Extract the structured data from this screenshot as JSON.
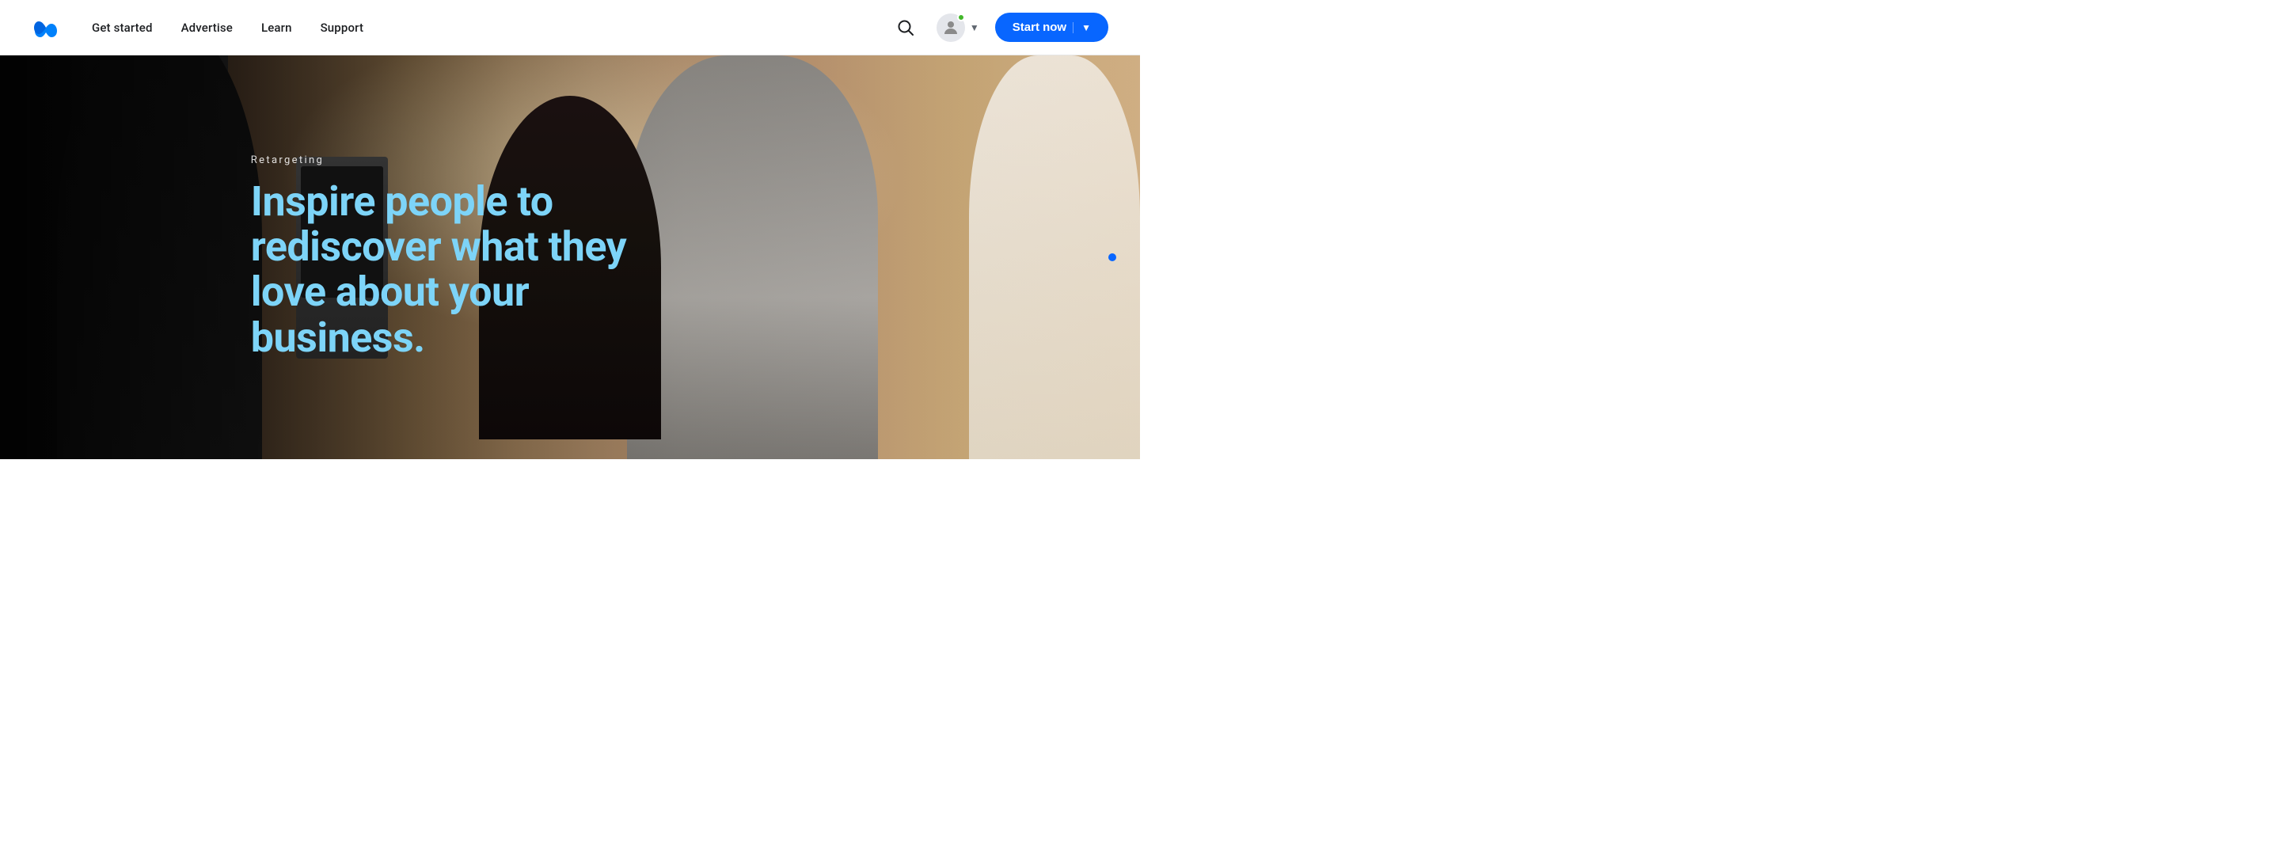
{
  "logo": {
    "alt": "Meta logo",
    "text": "Meta"
  },
  "navbar": {
    "links": [
      {
        "label": "Get started",
        "id": "get-started"
      },
      {
        "label": "Advertise",
        "id": "advertise"
      },
      {
        "label": "Learn",
        "id": "learn"
      },
      {
        "label": "Support",
        "id": "support"
      }
    ],
    "start_now_label": "Start now",
    "search_aria": "Search"
  },
  "hero": {
    "label": "Retargeting",
    "title_line1": "Inspire people to",
    "title_line2": "rediscover what they",
    "title_line3": "love about your",
    "title_line4": "business."
  },
  "colors": {
    "accent_blue": "#0866ff",
    "text_white": "#ffffff",
    "text_label": "rgba(255,255,255,0.85)"
  }
}
